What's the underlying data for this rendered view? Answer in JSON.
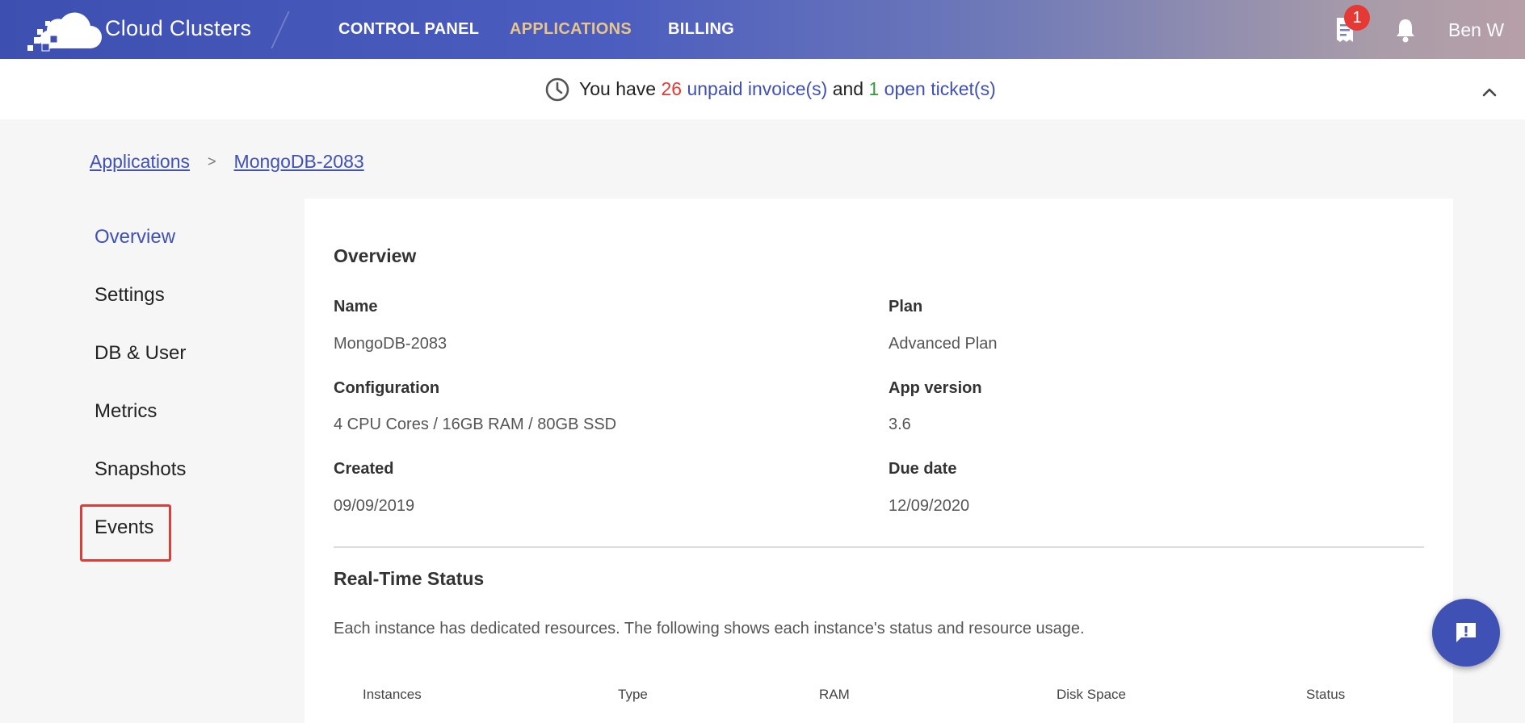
{
  "header": {
    "brand": "Cloud Clusters",
    "nav": {
      "control_panel": "CONTROL PANEL",
      "applications": "APPLICATIONS",
      "billing": "BILLING"
    },
    "invoice_badge": "1",
    "user": "Ben W"
  },
  "notice": {
    "prefix": "You have",
    "invoice_count": "26",
    "invoice_link": "unpaid invoice(s)",
    "and": "and",
    "ticket_count": "1",
    "ticket_link": "open ticket(s)"
  },
  "breadcrumb": {
    "root": "Applications",
    "separator": ">",
    "current": "MongoDB-2083"
  },
  "sidebar": {
    "items": [
      {
        "label": "Overview",
        "active": true
      },
      {
        "label": "Settings"
      },
      {
        "label": "DB & User"
      },
      {
        "label": "Metrics"
      },
      {
        "label": "Snapshots"
      },
      {
        "label": "Events"
      }
    ]
  },
  "overview": {
    "title": "Overview",
    "name_label": "Name",
    "name_value": "MongoDB-2083",
    "plan_label": "Plan",
    "plan_value": "Advanced Plan",
    "config_label": "Configuration",
    "config_value": "4 CPU Cores / 16GB RAM / 80GB SSD",
    "version_label": "App version",
    "version_value": "3.6",
    "created_label": "Created",
    "created_value": "09/09/2019",
    "due_label": "Due date",
    "due_value": "12/09/2020"
  },
  "status": {
    "title": "Real-Time Status",
    "description": "Each instance has dedicated resources. The following shows each instance's status and resource usage.",
    "columns": [
      "Instances",
      "Type",
      "RAM",
      "Disk Space",
      "Status"
    ]
  },
  "colors": {
    "primary": "#3f51b5",
    "accent_nav": "#e8c58a",
    "alert": "#e53935",
    "success": "#2e9e3a"
  },
  "icons": [
    "cloud-logo-icon",
    "invoice-icon",
    "bell-icon",
    "clock-icon",
    "chevron-up-icon",
    "feedback-icon"
  ]
}
